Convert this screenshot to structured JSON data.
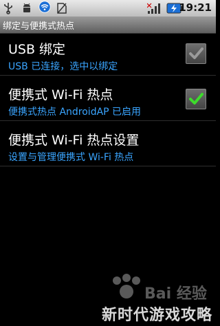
{
  "status_bar": {
    "time": "19:21",
    "icons": [
      "usb-icon",
      "android-icon",
      "wifi-hotspot-icon",
      "no-sim-icon",
      "signal-icon",
      "battery-charging-icon"
    ]
  },
  "screen": {
    "title": "绑定与便携式热点"
  },
  "settings": [
    {
      "title": "USB 绑定",
      "summary": "USB 已连接，选中以绑定",
      "checkbox": "disabled-checked"
    },
    {
      "title": "便携式 Wi-Fi 热点",
      "summary": "便携式热点 AndroidAP 已启用",
      "checkbox": "checked"
    },
    {
      "title": "便携式 Wi-Fi 热点设置",
      "summary": "设置与管理便携式 Wi-Fi 热点",
      "checkbox": "none"
    }
  ],
  "watermark": {
    "text": "新时代游戏攻略"
  },
  "colors": {
    "summary_text": "#3aa5ff",
    "check_green": "#3ddc2b",
    "check_gray": "#9a9a9a"
  }
}
